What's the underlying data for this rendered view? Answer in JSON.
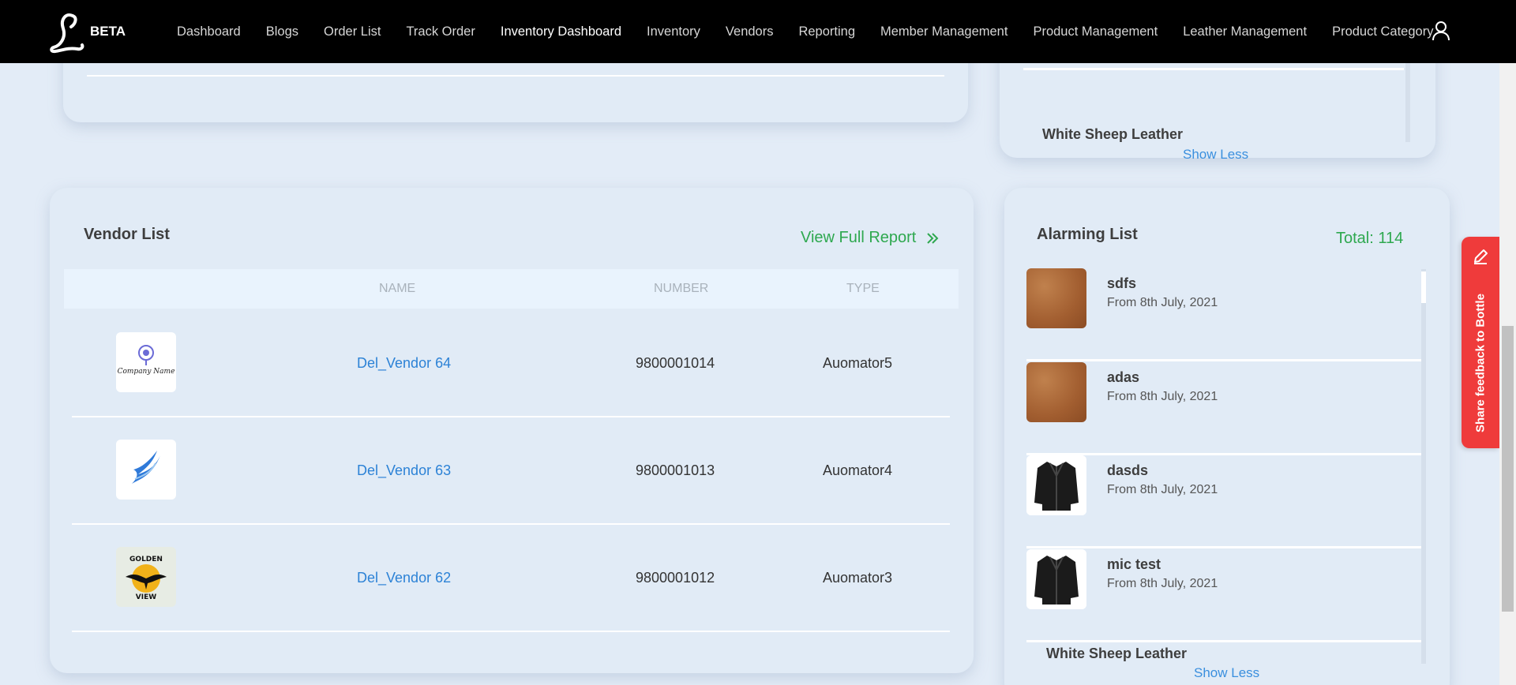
{
  "nav": {
    "beta": "BETA",
    "links": [
      "Dashboard",
      "Blogs",
      "Order List",
      "Track Order",
      "Inventory Dashboard",
      "Inventory",
      "Vendors",
      "Reporting",
      "Member Management",
      "Product Management",
      "Leather Management",
      "Product Category"
    ],
    "active": "Inventory Dashboard"
  },
  "top_right_card": {
    "title": "White Sheep Leather",
    "show_less": "Show Less"
  },
  "vendor_list": {
    "title": "Vendor List",
    "view_full_report": "View Full Report",
    "headers": {
      "name": "NAME",
      "number": "NUMBER",
      "type": "TYPE"
    },
    "rows": [
      {
        "name": "Del_Vendor 64",
        "number": "9800001014",
        "type": "Auomator5",
        "logo_text": "Company Name"
      },
      {
        "name": "Del_Vendor 63",
        "number": "9800001013",
        "type": "Auomator4",
        "logo_text": ""
      },
      {
        "name": "Del_Vendor 62",
        "number": "9800001012",
        "type": "Auomator3",
        "logo_text": "GOLDEN VIEW"
      }
    ]
  },
  "alarming_list": {
    "title": "Alarming List",
    "total": "Total: 114",
    "items": [
      {
        "name": "sdfs",
        "date": "From 8th July, 2021",
        "thumb": "leather"
      },
      {
        "name": "adas",
        "date": "From 8th July, 2021",
        "thumb": "leather"
      },
      {
        "name": "dasds",
        "date": "From 8th July, 2021",
        "thumb": "jacket"
      },
      {
        "name": "mic test",
        "date": "From 8th July, 2021",
        "thumb": "jacket"
      }
    ],
    "footer_title": "White Sheep Leather",
    "show_less": "Show Less"
  },
  "feedback": {
    "label": "Share feedback to Bottle"
  },
  "colors": {
    "accent_green": "#2ea84f",
    "link_blue": "#2c82d6",
    "feedback_red": "#ef3b3b"
  }
}
